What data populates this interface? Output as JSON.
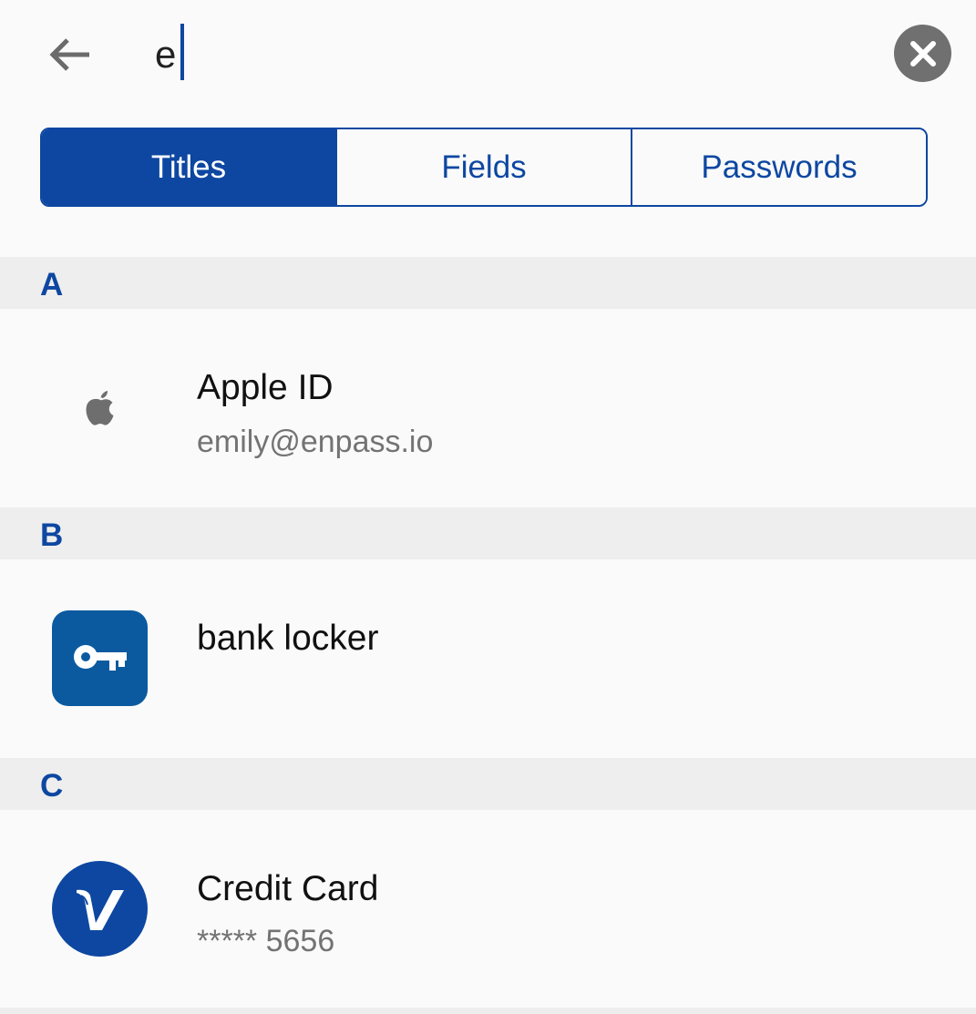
{
  "search": {
    "query": "e",
    "back_icon": "arrow-left-icon",
    "clear_icon": "close-circle-icon"
  },
  "filters": {
    "tabs": [
      {
        "label": "Titles",
        "active": true
      },
      {
        "label": "Fields",
        "active": false
      },
      {
        "label": "Passwords",
        "active": false
      }
    ]
  },
  "sections": [
    {
      "letter": "A",
      "items": [
        {
          "title": "Apple ID",
          "subtitle": "emily@enpass.io",
          "icon": "apple-logo-icon"
        }
      ]
    },
    {
      "letter": "B",
      "items": [
        {
          "title": "bank locker",
          "subtitle": "",
          "icon": "key-icon"
        }
      ]
    },
    {
      "letter": "C",
      "items": [
        {
          "title": "Credit Card",
          "subtitle": "***** 5656",
          "icon": "visa-logo-icon"
        }
      ]
    }
  ],
  "colors": {
    "accent": "#0d47a1",
    "section_background": "#eeeeee",
    "background": "#fafafa",
    "key_icon_background": "#0b5aa0",
    "clear_button": "#707070",
    "subtitle_text": "#737373"
  }
}
